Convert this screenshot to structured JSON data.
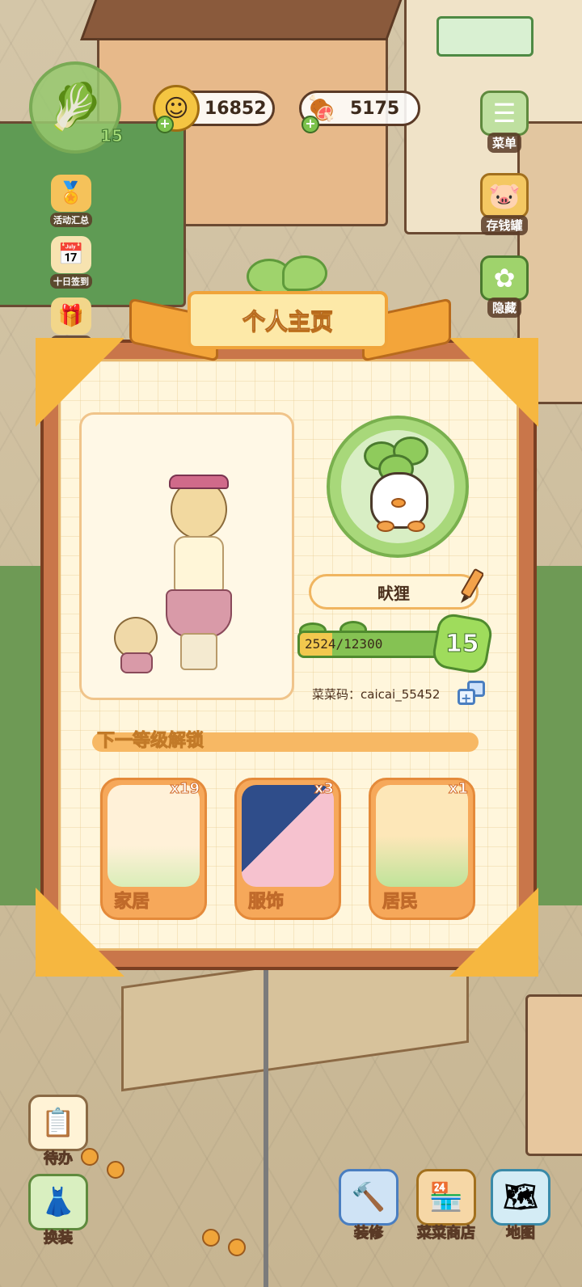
{
  "hud": {
    "player_level": "15",
    "coins": "16852",
    "meat": "5175"
  },
  "left_menu": {
    "activity_summary": "活动汇总",
    "ten_day_signin": "十日签到",
    "upgrade_reward": "升级奖励",
    "todo": "待办",
    "dress_up": "换装"
  },
  "right_menu": {
    "menu": "菜单",
    "piggy_bank": "存钱罐",
    "hide": "隐藏"
  },
  "bottom_menu": {
    "decorate": "装修",
    "caicai_shop": "菜菜商店",
    "map": "地图"
  },
  "profile": {
    "title": "个人主页",
    "nickname": "畎狸",
    "xp_current": 2524,
    "xp_max": 12300,
    "xp_text": "2524/12300",
    "level": "15",
    "caicai_code": "菜菜码：caicai_55452"
  },
  "unlock": {
    "header": "下一等级解锁",
    "items": [
      {
        "label": "家居",
        "count": "x19"
      },
      {
        "label": "服饰",
        "count": "x3"
      },
      {
        "label": "居民",
        "count": "x1"
      }
    ]
  },
  "colors": {
    "panel_frame": "#c9764a",
    "panel_paper": "#fff6dc",
    "accent_orange": "#f6a85a",
    "leaf_green": "#85c253",
    "xp_fill": "#f2c84e"
  }
}
